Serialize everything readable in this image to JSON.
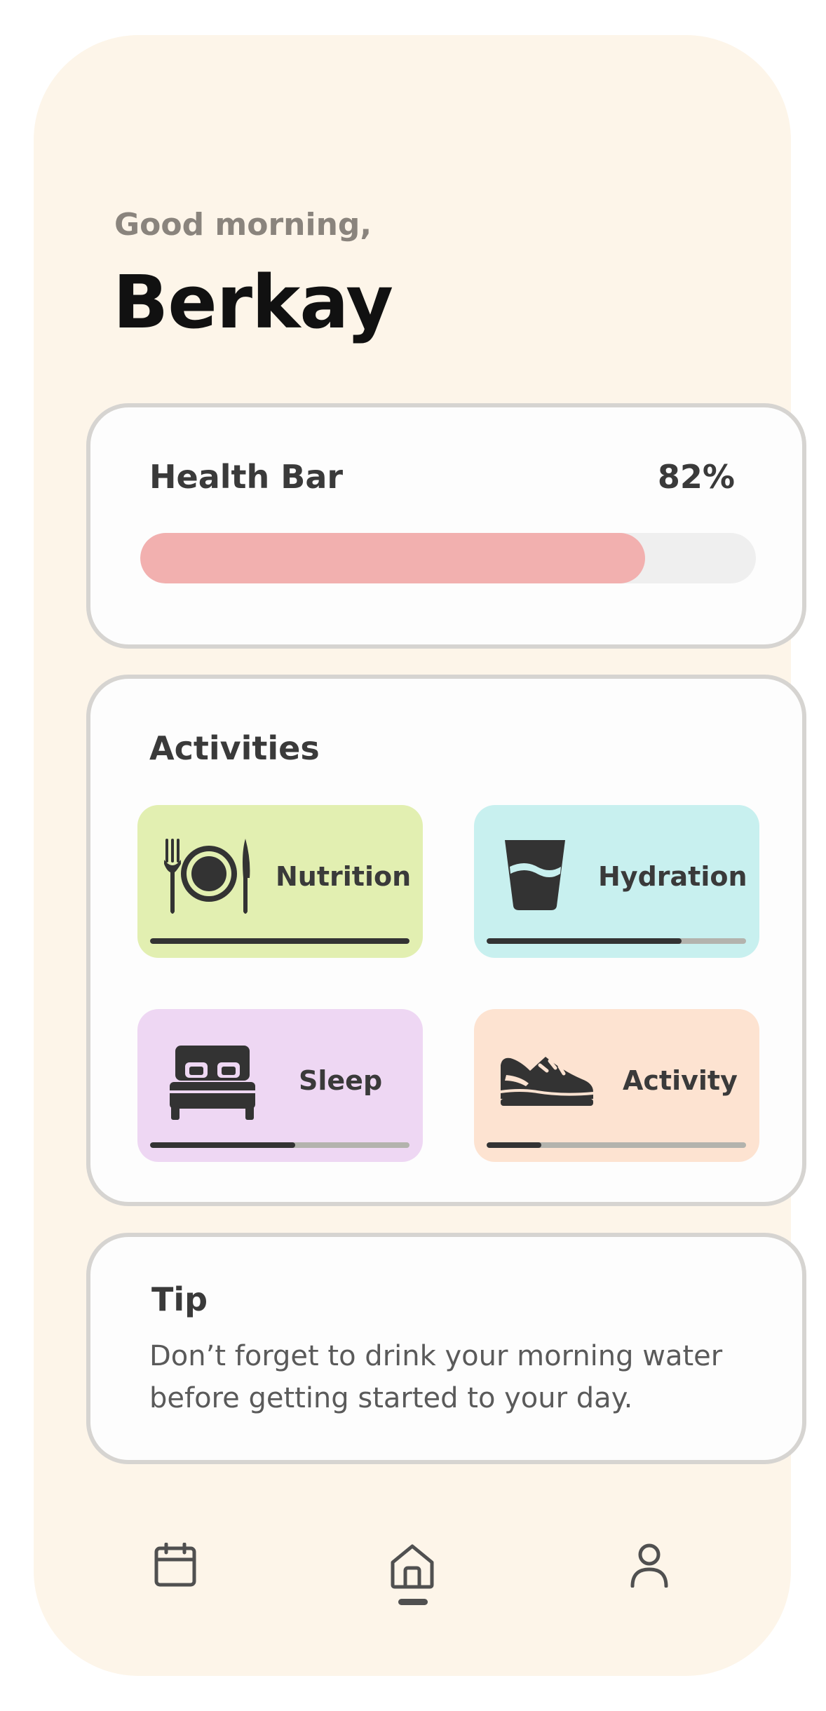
{
  "header": {
    "greeting": "Good morning,",
    "name": "Berkay"
  },
  "health": {
    "title": "Health Bar",
    "percent_label": "82%",
    "percent": 82,
    "fill_color": "#f2b0af",
    "track_color": "#efefef"
  },
  "activities": {
    "title": "Activities",
    "items": [
      {
        "label": "Nutrition",
        "icon": "utensils-plate-icon",
        "color": "#e2efb1",
        "progress": 1.0
      },
      {
        "label": "Hydration",
        "icon": "water-glass-icon",
        "color": "#c8f0ef",
        "progress": 0.75
      },
      {
        "label": "Sleep",
        "icon": "bed-icon",
        "color": "#eed7f3",
        "progress": 0.56
      },
      {
        "label": "Activity",
        "icon": "sneaker-icon",
        "color": "#fde3d1",
        "progress": 0.21
      }
    ]
  },
  "tip": {
    "title": "Tip",
    "text": "Don’t forget to drink your morning water before getting started to your day."
  },
  "nav": {
    "items": [
      {
        "icon": "calendar-icon"
      },
      {
        "icon": "home-icon",
        "active": true
      },
      {
        "icon": "profile-icon"
      }
    ]
  }
}
